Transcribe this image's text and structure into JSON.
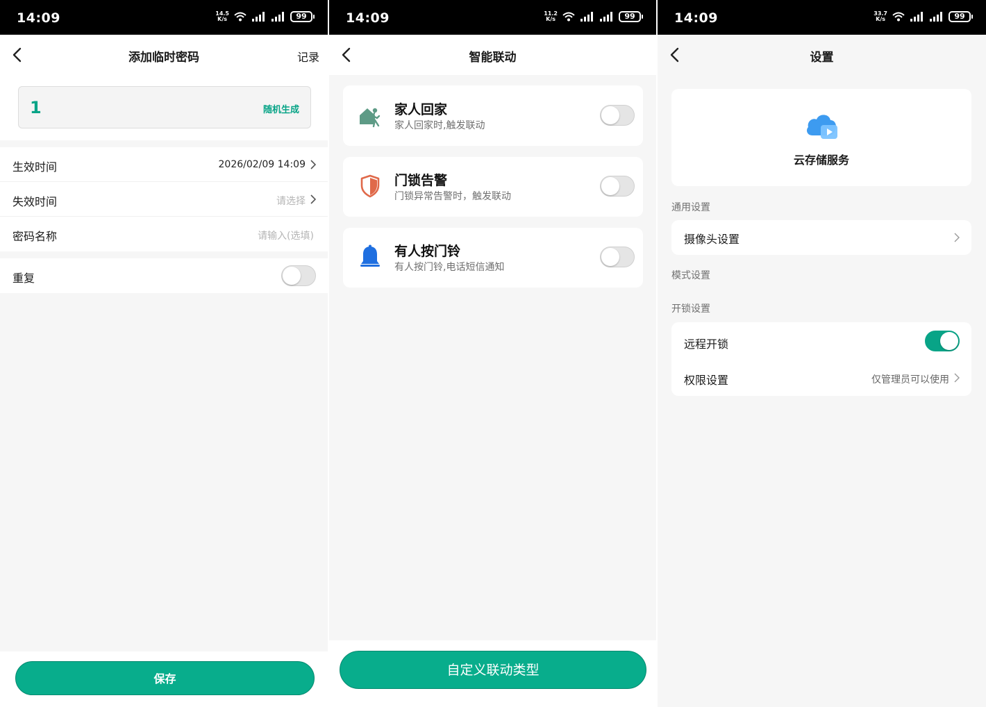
{
  "status_bar": {
    "time": "14:09",
    "battery": "99",
    "speeds": [
      "14.5",
      "11.2",
      "33.7"
    ],
    "speed_unit": "K/s"
  },
  "temp_password": {
    "title": "添加临时密码",
    "record_link": "记录",
    "password_value": "1",
    "random_generate": "随机生成",
    "rows": [
      {
        "label": "生效时间",
        "value": "2026/02/09 14:09"
      },
      {
        "label": "失效时间",
        "value": "请选择"
      },
      {
        "label": "密码名称",
        "value": "请输入(选填)"
      }
    ],
    "repeat_label": "重复",
    "repeat_on": false,
    "save_button": "保存"
  },
  "smart_linkage": {
    "title": "智能联动",
    "items": [
      {
        "title": "家人回家",
        "desc": "家人回家时,触发联动",
        "icon": "person-home-icon",
        "enabled": false
      },
      {
        "title": "门锁告警",
        "desc": "门锁异常告警时，触发联动",
        "icon": "shield-icon",
        "enabled": false
      },
      {
        "title": "有人按门铃",
        "desc": "有人按门铃,电话短信通知",
        "icon": "bell-icon",
        "enabled": false
      }
    ],
    "custom_button": "自定义联动类型"
  },
  "settings": {
    "title": "设置",
    "cloud_service": "云存储服务",
    "general_section": "通用设置",
    "camera_settings": "摄像头设置",
    "mode_section": "模式设置",
    "unlock_section": "开锁设置",
    "remote_unlock": "远程开锁",
    "remote_unlock_on": true,
    "permission_label": "权限设置",
    "permission_value": "仅管理员可以使用"
  },
  "colors": {
    "accent": "#08ad8c",
    "alert_orange": "#e0694a",
    "bell_blue": "#1f6fe0",
    "home_green": "#5e9b86",
    "cloud_blue": "#3d9bf0"
  }
}
